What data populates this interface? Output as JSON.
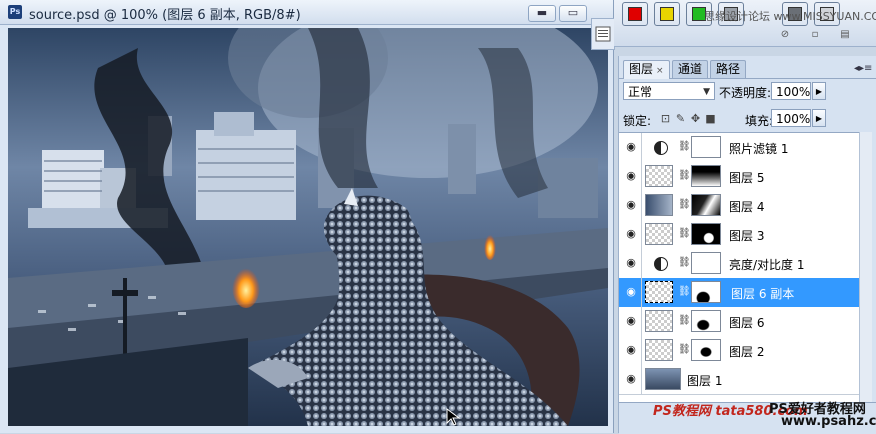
{
  "document": {
    "app_badge": "Ps",
    "title": "source.psd @ 100% (图层 6 副本, RGB/8#)",
    "minimize_label": "▬",
    "restore_label": "▭",
    "cursor": "pointer-cursor"
  },
  "swatches": [
    {
      "name": "red",
      "color": "#e00000"
    },
    {
      "name": "yellow",
      "color": "#e8d400"
    },
    {
      "name": "green",
      "color": "#22bb22"
    },
    {
      "name": "grey-1",
      "color": "#9aa0a8"
    },
    {
      "name": "grey-2",
      "color": "#6a6f76"
    },
    {
      "name": "grey-3",
      "color": "#d0d3d8"
    }
  ],
  "top_watermark": "思缘设计论坛  www.MISSYUAN.COM",
  "panel": {
    "tabs": [
      {
        "label": "图层",
        "close": "×",
        "active": true
      },
      {
        "label": "通道",
        "active": false
      },
      {
        "label": "路径",
        "active": false
      }
    ],
    "menu_icon": "◂▸≡",
    "blend_mode": "正常",
    "opacity_label": "不透明度:",
    "opacity_value": "100%",
    "lock_label": "锁定:",
    "fill_label": "填充:",
    "fill_value": "100%",
    "layers": [
      {
        "name": "照片滤镜 1",
        "kind": "adjustment",
        "selected": false
      },
      {
        "name": "图层 5",
        "kind": "masked",
        "selected": false
      },
      {
        "name": "图层 4",
        "kind": "masked",
        "selected": false
      },
      {
        "name": "图层 3",
        "kind": "masked",
        "selected": false
      },
      {
        "name": "亮度/对比度 1",
        "kind": "adjustment",
        "selected": false
      },
      {
        "name": "图层 6 副本",
        "kind": "masked",
        "selected": true
      },
      {
        "name": "图层 6",
        "kind": "masked",
        "selected": false
      },
      {
        "name": "图层 2",
        "kind": "masked",
        "selected": false
      },
      {
        "name": "图层 1",
        "kind": "image",
        "selected": false
      }
    ]
  },
  "bottom_watermark": {
    "left": "PS教程网  tata580.com",
    "right_line1": "PS爱好者教程网",
    "right_line2": "www.psahz.com"
  },
  "colors": {
    "selection": "#3399ff",
    "panel_bg": "#d6e2f1",
    "accent_red": "#c2261d"
  }
}
